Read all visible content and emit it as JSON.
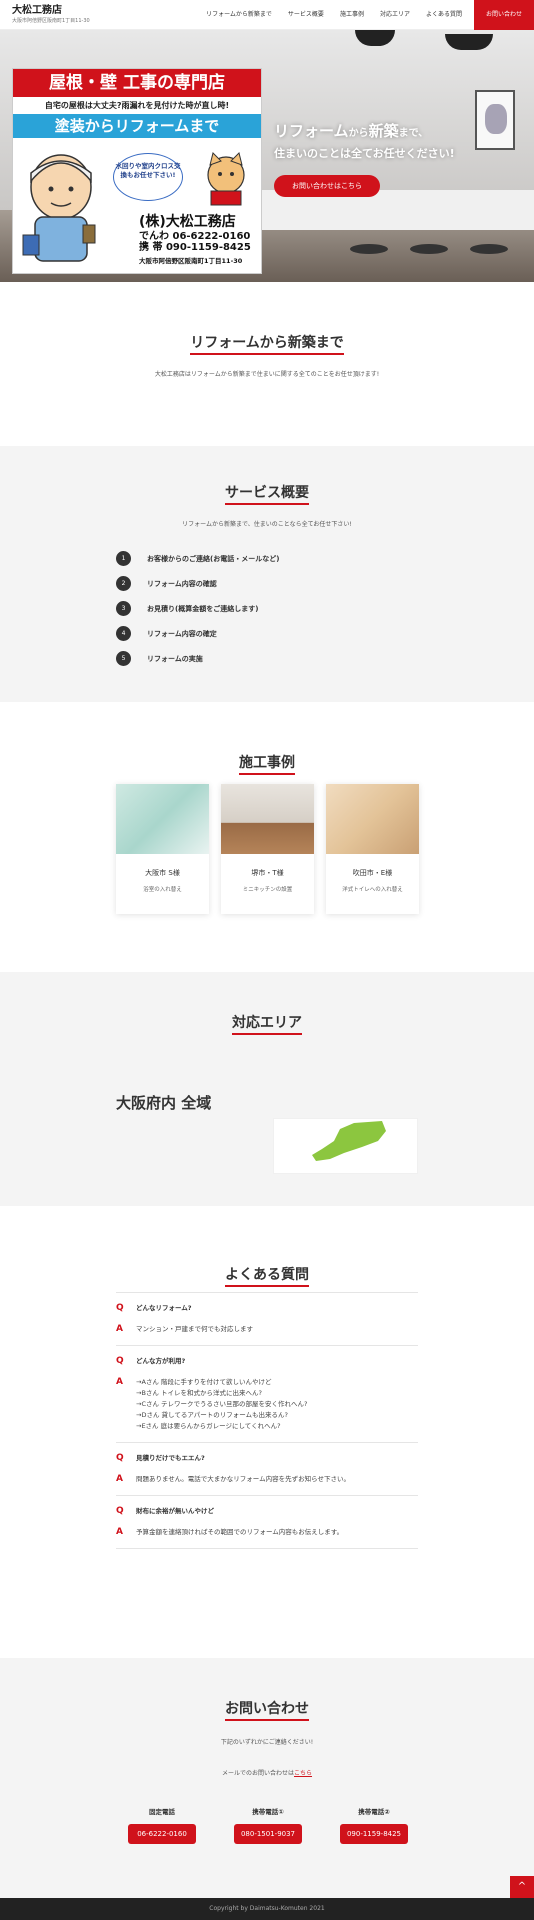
{
  "header": {
    "site_name": "大松工務店",
    "address": "大阪市阿倍野区阪南町1丁目11-30",
    "nav": [
      "リフォームから新築まで",
      "サービス概要",
      "施工事例",
      "対応エリア",
      "よくある質問"
    ],
    "cta": "お問い合わせ"
  },
  "sign": {
    "headline": "屋根・壁 工事の専門店",
    "subline": "自宅の屋根は大丈夫?雨漏れを見付けた時が直し時!",
    "band": "塗装からリフォームまで",
    "bubble": "水回りや室内クロス交換もお任せ下さい!",
    "company": "(株)大松工務店",
    "phone_line": "でんわ 06-6222-0160",
    "mobile_line": "携 帯 090-1159-8425",
    "address": "大阪市阿倍野区阪南町1丁目11-30"
  },
  "hero": {
    "line1_a": "リフォーム",
    "line1_b": "から",
    "line1_c": "新築",
    "line1_d": "まで、",
    "line2": "住まいのことは全てお任せください!",
    "button": "お問い合わせはこちら"
  },
  "reform": {
    "title": "リフォームから新築まで",
    "text": "大松工務店はリフォームから新築まで住まいに関する全てのことをお任せ頂けます!"
  },
  "service": {
    "title": "サービス概要",
    "lead": "リフォームから新築まで、住まいのことなら全てお任せ下さい!",
    "steps": [
      {
        "num": "1",
        "text": "お客様からのご連絡(お電話・メールなど)"
      },
      {
        "num": "2",
        "text": "リフォーム内容の確認"
      },
      {
        "num": "3",
        "text": "お見積り(概算金額をご連絡します)"
      },
      {
        "num": "4",
        "text": "リフォーム内容の確定"
      },
      {
        "num": "5",
        "text": "リフォームの実施"
      }
    ]
  },
  "works": {
    "title": "施工事例",
    "cards": [
      {
        "title": "大阪市 S様",
        "desc": "浴室の入れ替え"
      },
      {
        "title": "堺市・T様",
        "desc": "ミニキッチンの設置"
      },
      {
        "title": "吹田市・E様",
        "desc": "洋式トイレへの入れ替え"
      }
    ]
  },
  "area": {
    "title": "対応エリア",
    "text": "大阪府内 全域"
  },
  "faq": {
    "title": "よくある質問",
    "items": [
      {
        "q": "どんなリフォーム?",
        "a": [
          "マンション・戸建まで何でも対応します"
        ]
      },
      {
        "q": "どんな方が利用?",
        "a": [
          "→Aさん 階段に手すりを付けて欲しいんやけど",
          "→Bさん トイレを和式から洋式に出来へん?",
          "→Cさん テレワークでうるさい旦那の部屋を安く作れへん?",
          "→Dさん 貸してるアパートのリフォームも出来るん?",
          "→Eさん 庭は要らんからガレージにしてくれへん?"
        ]
      },
      {
        "q": "見積りだけでもエエん?",
        "a": [
          "問題ありません。電話で大まかなリフォーム内容を先ずお知らせ下さい。"
        ]
      },
      {
        "q": "財布に余裕が無いんやけど",
        "a": [
          "予算金額を連絡頂ければその範囲でのリフォーム内容もお伝えします。"
        ]
      }
    ]
  },
  "contact": {
    "title": "お問い合わせ",
    "lead": "下記のいずれかにご連絡ください!",
    "mail_text": "メールでのお問い合わせは",
    "mail_link": "こちら",
    "cols": [
      {
        "label": "固定電話",
        "tel": "06-6222-0160"
      },
      {
        "label": "携帯電話①",
        "tel": "080-1501-9037"
      },
      {
        "label": "携帯電話②",
        "tel": "090-1159-8425"
      }
    ]
  },
  "footer": {
    "copyright": "Copyright by Daimatsu-Komuten 2021"
  },
  "totop": "^",
  "markers": {
    "q": "Q",
    "a": "A"
  },
  "colors": {
    "accent": "#d0121b",
    "sign_band": "#2aa3d8"
  }
}
